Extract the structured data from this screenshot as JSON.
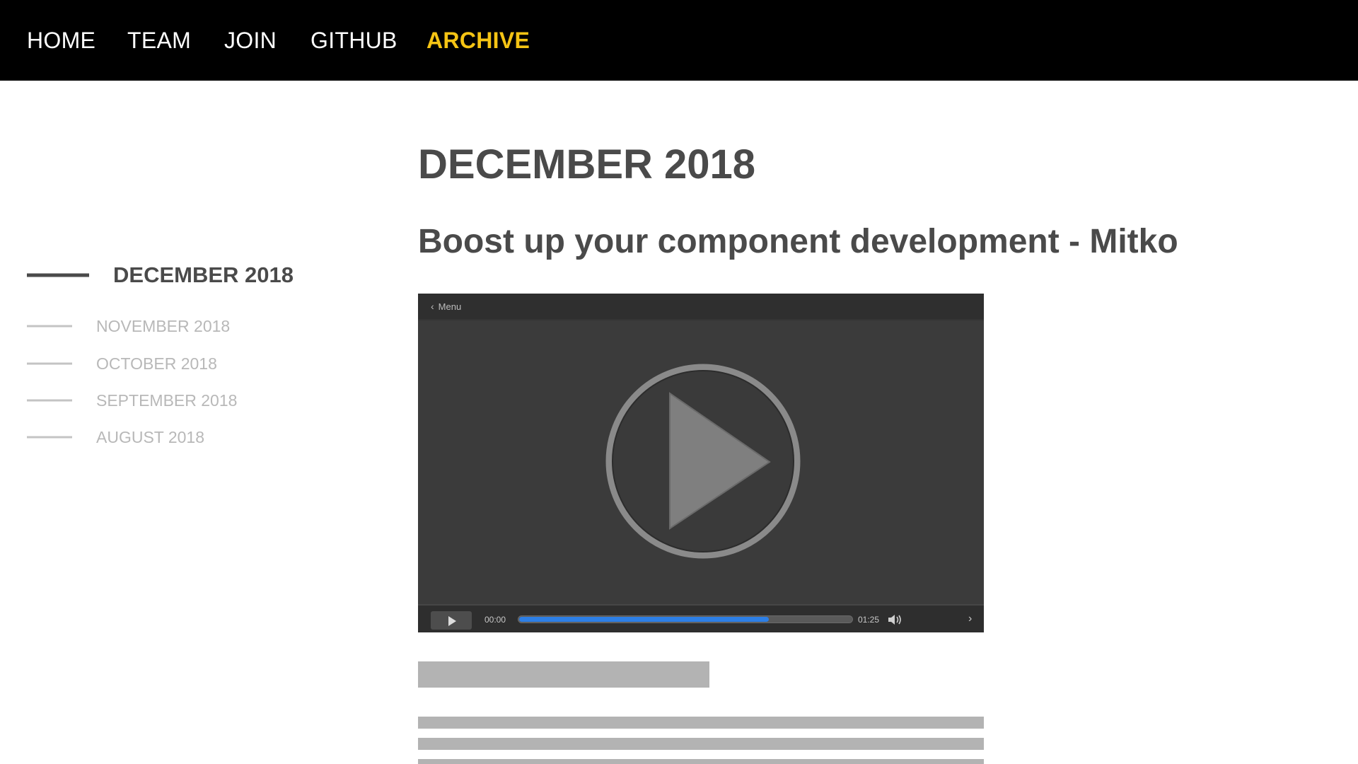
{
  "nav": {
    "items": [
      {
        "label": "HOME"
      },
      {
        "label": "TEAM"
      },
      {
        "label": "JOIN"
      },
      {
        "label": "GITHUB"
      },
      {
        "label": "ARCHIVE"
      }
    ],
    "active": "ARCHIVE",
    "active_color": "#f5c414"
  },
  "sidebar": {
    "current": "DECEMBER 2018",
    "items": [
      {
        "label": "DECEMBER 2018"
      },
      {
        "label": "NOVEMBER 2018"
      },
      {
        "label": "OCTOBER 2018"
      },
      {
        "label": "SEPTEMBER 2018"
      },
      {
        "label": "AUGUST 2018"
      }
    ]
  },
  "main": {
    "page_title": "DECEMBER 2018",
    "post_title": "Boost up your component development - Mitko"
  },
  "player": {
    "menu_label": "Menu",
    "current_time": "00:00",
    "duration": "01:25",
    "progress_fraction": 0.75,
    "progress_color": "#2d7fe6"
  }
}
